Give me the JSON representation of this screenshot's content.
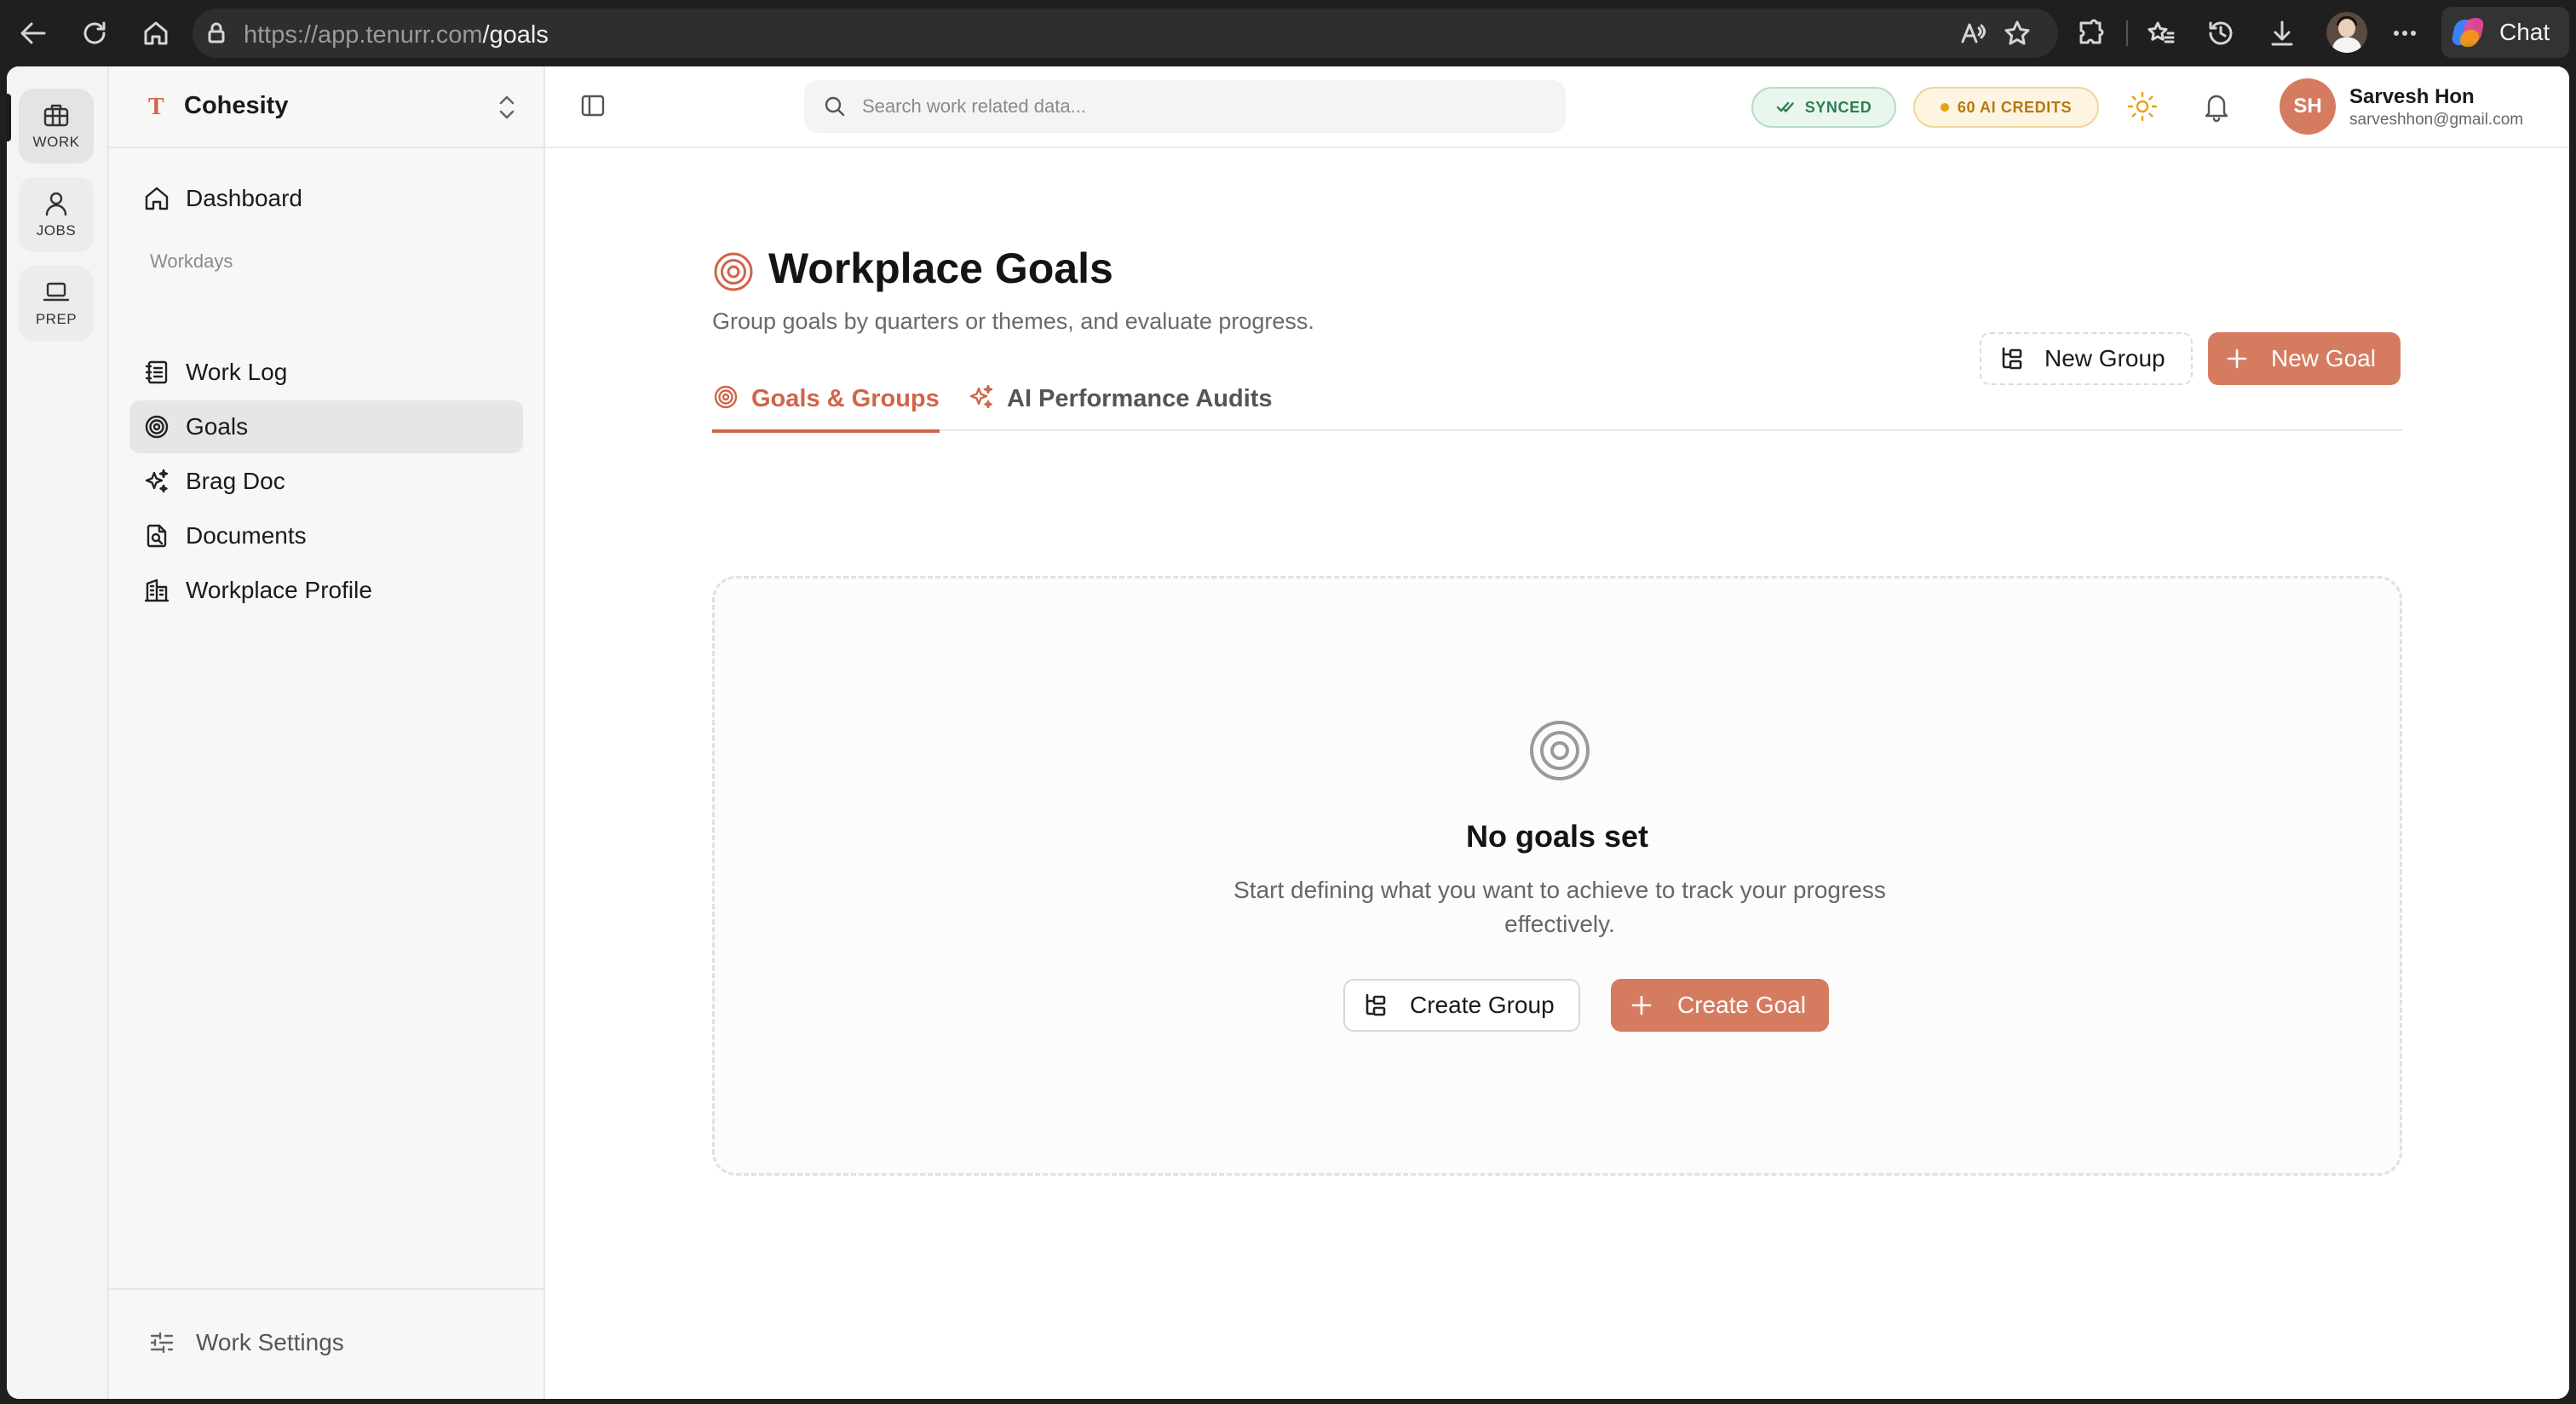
{
  "browser": {
    "url_origin": "https://app.tenurr.com",
    "url_path": "/goals",
    "chat_label": "Chat"
  },
  "rail": {
    "items": [
      {
        "label": "WORK",
        "icon": "briefcase-icon",
        "active": true
      },
      {
        "label": "JOBS",
        "icon": "person-icon",
        "active": false
      },
      {
        "label": "PREP",
        "icon": "laptop-icon",
        "active": false
      }
    ]
  },
  "sidebar": {
    "org_logo": "T",
    "org_name": "Cohesity",
    "items": [
      {
        "label": "Dashboard",
        "icon": "home-icon"
      },
      {
        "label": "Work Log",
        "icon": "notebook-icon"
      },
      {
        "label": "Goals",
        "icon": "target-icon",
        "active": true
      },
      {
        "label": "Brag Doc",
        "icon": "sparkles-icon"
      },
      {
        "label": "Documents",
        "icon": "document-search-icon"
      },
      {
        "label": "Workplace Profile",
        "icon": "building-icon"
      }
    ],
    "section_label": "Workdays",
    "footer_label": "Work Settings"
  },
  "topbar": {
    "search_placeholder": "Search work related data...",
    "synced_label": "SYNCED",
    "credits_label": "60 AI CREDITS",
    "user_initials": "SH",
    "user_name": "Sarvesh Hon",
    "user_email": "sarveshhon@gmail.com"
  },
  "main": {
    "title": "Workplace Goals",
    "subtitle": "Group goals by quarters or themes, and evaluate progress.",
    "new_group_label": "New Group",
    "new_goal_label": "New Goal",
    "tabs": [
      {
        "label": "Goals & Groups",
        "active": true
      },
      {
        "label": "AI Performance Audits",
        "active": false
      }
    ],
    "empty": {
      "title": "No goals set",
      "description": "Start defining what you want to achieve to track your progress effectively.",
      "create_group_label": "Create Group",
      "create_goal_label": "Create Goal"
    }
  },
  "colors": {
    "accent": "#d57b60",
    "accent_text": "#d0654a",
    "synced_green": "#2f7d52",
    "credits_amber": "#e5a117"
  }
}
